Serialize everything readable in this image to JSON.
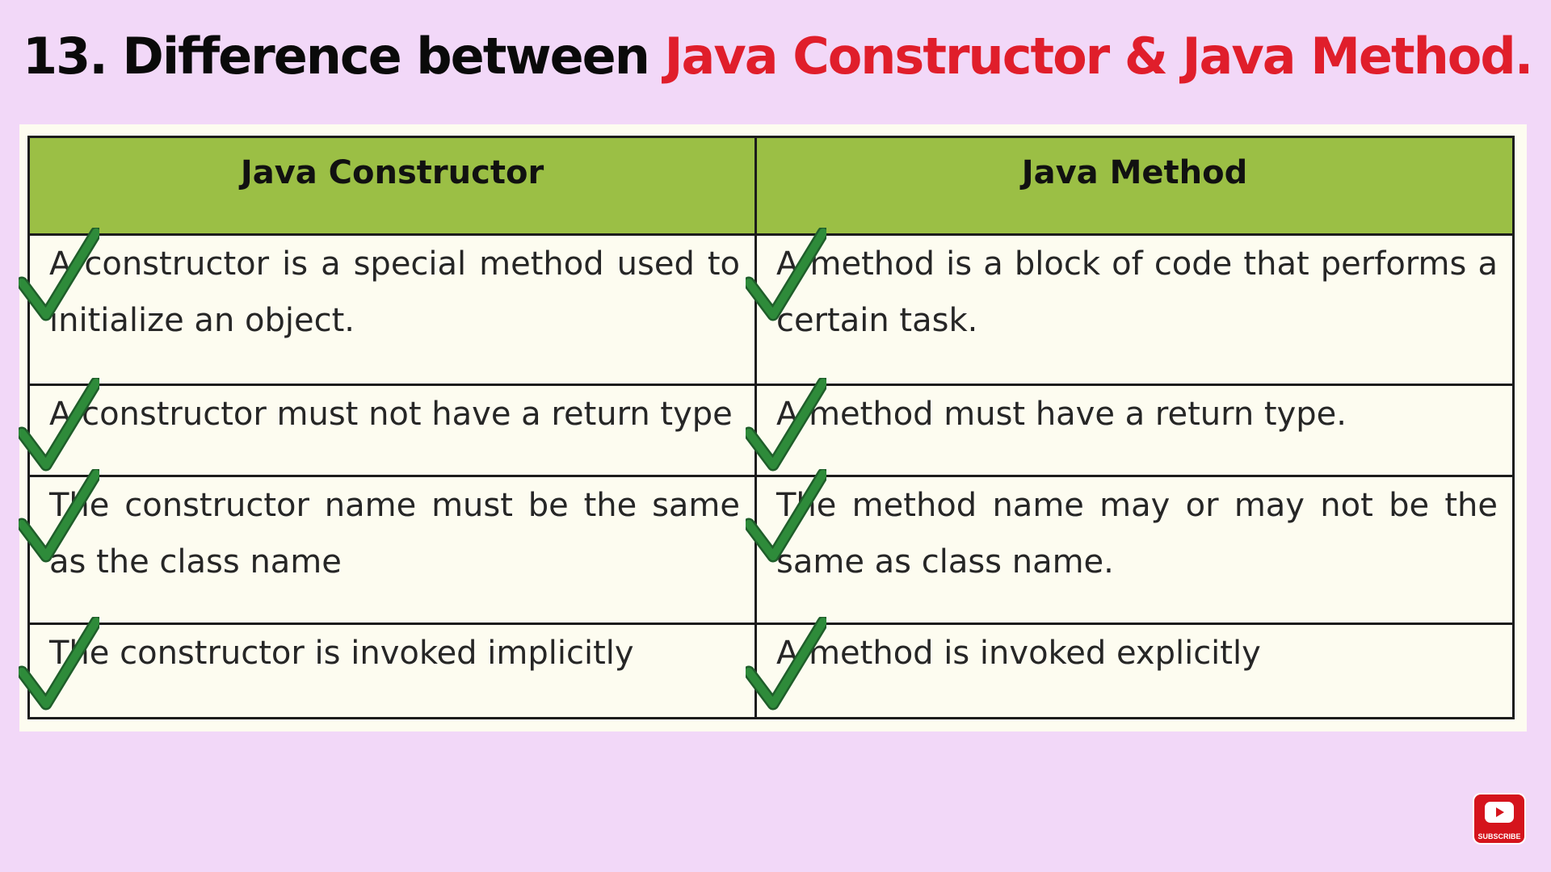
{
  "title": {
    "prefix": "13. Difference between ",
    "highlight": "Java Constructor & Java Method."
  },
  "table": {
    "headers": [
      "Java Constructor",
      "Java Method"
    ],
    "rows": [
      [
        "A constructor is a special method used to initialize an object.",
        "A method is a block of code that performs a certain task."
      ],
      [
        "A constructor must not have a return type",
        "A method must have a return type."
      ],
      [
        "The constructor name must be the same as the class name",
        "The method name may or may not be the same as class name."
      ],
      [
        "The constructor is invoked implicitly",
        "A method is invoked explicitly"
      ]
    ]
  },
  "subscribe": {
    "label": "SUBSCRIBE",
    "icon": "youtube-play-icon"
  },
  "colors": {
    "background": "#f2d8f8",
    "title_accent": "#e01e2b",
    "header_fill": "#9bbf45",
    "check_mark": "#2e8b3a",
    "subscribe_red": "#d5141c"
  }
}
